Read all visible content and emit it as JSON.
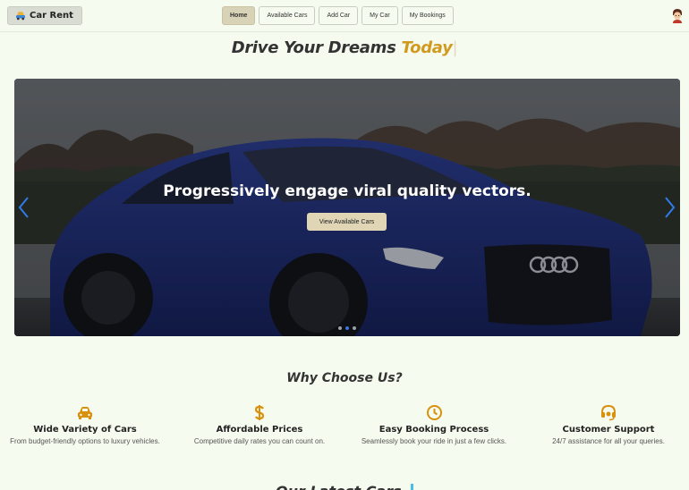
{
  "navbar": {
    "brand_label": "Car Rent",
    "brand_icon": "car-icon",
    "links": [
      {
        "label": "Home",
        "active": true
      },
      {
        "label": "Available Cars",
        "active": false
      },
      {
        "label": "Add Car",
        "active": false
      },
      {
        "label": "My Car",
        "active": false
      },
      {
        "label": "My Bookings",
        "active": false
      }
    ],
    "avatar_icon": "user-avatar"
  },
  "hero": {
    "title_main": "Drive Your Dreams",
    "title_accent": "Today",
    "title_cursor": "|",
    "accent_color": "#d19a1e"
  },
  "carousel": {
    "caption": "Progressively engage viral quality vectors.",
    "button_label": "View Available Cars",
    "slide_count": 3,
    "active_slide": 2,
    "active_dot_color": "#3b74e0",
    "arrow_color": "#2f7be8"
  },
  "why": {
    "title": "Why Choose Us?",
    "icon_color": "#d8900d",
    "features": [
      {
        "icon": "car-icon",
        "title": "Wide Variety of Cars",
        "text": "From budget-friendly options to luxury vehicles."
      },
      {
        "icon": "dollar-icon",
        "title": "Affordable Prices",
        "text": "Competitive daily rates you can count on."
      },
      {
        "icon": "clock-icon",
        "title": "Easy Booking Process",
        "text": "Seamlessly book your ride in just a few clicks."
      },
      {
        "icon": "headset-icon",
        "title": "Customer Support",
        "text": "24/7 assistance for all your queries."
      }
    ]
  },
  "next_section": {
    "title_partial": "Our Latest Cars"
  }
}
